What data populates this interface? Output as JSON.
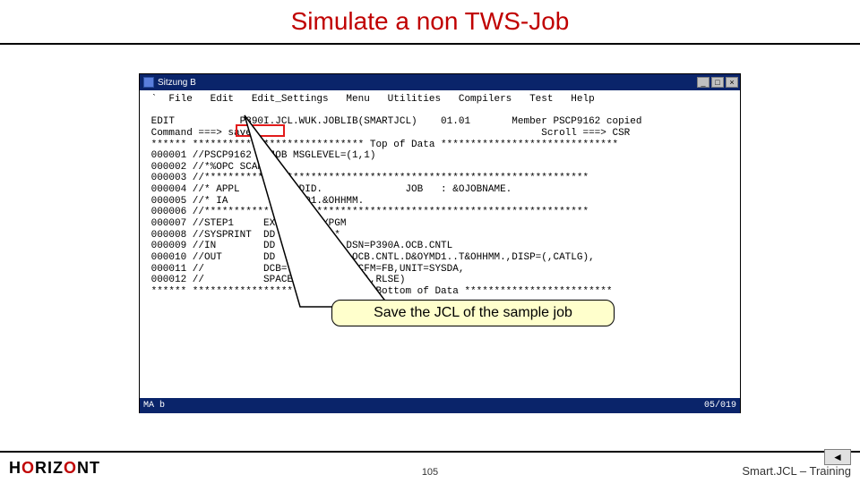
{
  "title": "Simulate a non TWS-Job",
  "term": {
    "window_title": "Sitzung B",
    "menubar": " `  File   Edit   Edit_Settings   Menu   Utilities   Compilers   Test   Help",
    "lines": [
      " EDIT           P390I.JCL.WUK.JOBLIB(SMARTJCL)    01.01       Member PSCP9162 copied",
      " Command ===> save_                                                Scroll ===> CSR",
      " ****** ***************************** Top of Data ******************************",
      " 000001 //PSCP9162   JOB MSGLEVEL=(1,1)",
      " 000002 //*%OPC SCAN",
      " 000003 //*****************************************************************",
      " 000004 //* APPL     : &OADID.              JOB   : &OJOBNAME.",
      " 000005 //* IA       : &OYMD1.&OHHMM.",
      " 000006 //*****************************************************************",
      " 000007 //STEP1     EXEC PGM=MYPGM",
      " 000008 //SYSPRINT  DD   SYSOUT=*",
      " 000009 //IN        DD   DISP=SHR,DSN=P390A.OCB.CNTL",
      " 000010 //OUT       DD   DSN=P390I.OCB.CNTL.D&OYMD1..T&OHHMM.,DISP=(,CATLG),",
      " 000011 //          DCB=(LRECL=80,RECFM=FB,UNIT=SYSDA,",
      " 000012 //          SPACE=(TRK,(15,15),RLSE)",
      " ****** ******************** ********* Bottom of Data *************************"
    ],
    "status_left": "MA      b",
    "status_right": "05/019"
  },
  "callout": {
    "text": "Save the JCL of the sample job"
  },
  "footer": {
    "horizont_letters": [
      "H",
      "O",
      "R",
      "I",
      "Z",
      "O",
      "N",
      "T"
    ],
    "horizont_colors": [
      "blk",
      "red",
      "blk",
      "blk",
      "blk",
      "red",
      "blk",
      "blk"
    ],
    "page": "105",
    "brand": "Smart.JCL – Training"
  }
}
